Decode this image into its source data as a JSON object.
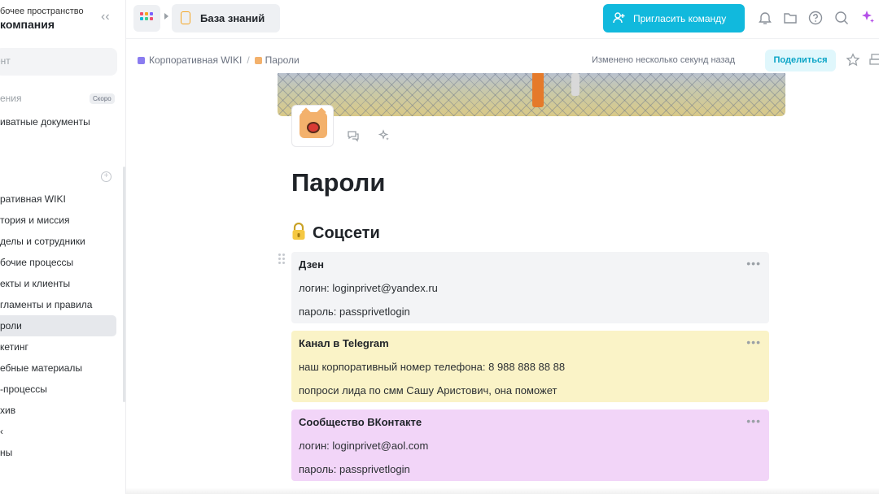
{
  "sidebar": {
    "workspace_subtitle": "бочее пространство",
    "workspace_name": "компания",
    "search_placeholder": "ент",
    "soon_label": "ения",
    "soon_badge": "Скоро",
    "private_docs": "иватные документы",
    "nav": [
      {
        "label": "ративная WIKI"
      },
      {
        "label": "тория и миссия"
      },
      {
        "label": "делы и сотрудники"
      },
      {
        "label": "бочие процессы"
      },
      {
        "label": "екты и клиенты"
      },
      {
        "label": "гламенты и правила"
      },
      {
        "label": "роли",
        "active": true
      },
      {
        "label": "кетинг"
      },
      {
        "label": "ебные материалы"
      },
      {
        "label": "-процессы"
      },
      {
        "label": "хив"
      },
      {
        "label": "‹"
      },
      {
        "label": "ны"
      }
    ]
  },
  "topbar": {
    "space_label": "База знаний",
    "invite_label": "Пригласить команду"
  },
  "breadcrumb": {
    "parent": "Корпоративная WIKI",
    "separator": "/",
    "current": "Пароли"
  },
  "status": {
    "edited": "Изменено несколько секунд назад",
    "share_label": "Поделиться"
  },
  "page": {
    "title": "Пароли",
    "section_title": "Соцсети",
    "cards": [
      {
        "title": "Дзен",
        "lines": [
          "логин: loginprivet@yandex.ru",
          "пароль: passprivetlogin"
        ],
        "color": "#f3f4f6"
      },
      {
        "title": "Канал в Telegram",
        "lines": [
          "наш корпоративный номер телефона: 8 988 888 88 88",
          "попроси лида по смм Сашу Аристович, она поможет"
        ],
        "color": "#faf3c7"
      },
      {
        "title": "Сообщество ВКонтакте",
        "lines": [
          "логин: loginprivet@aol.com",
          "пароль: passprivetlogin"
        ],
        "color": "#f2d5f8"
      }
    ],
    "more_glyph": "•••"
  },
  "colors": {
    "accent": "#11b9dd",
    "active_nav": "#e6e8ec"
  }
}
